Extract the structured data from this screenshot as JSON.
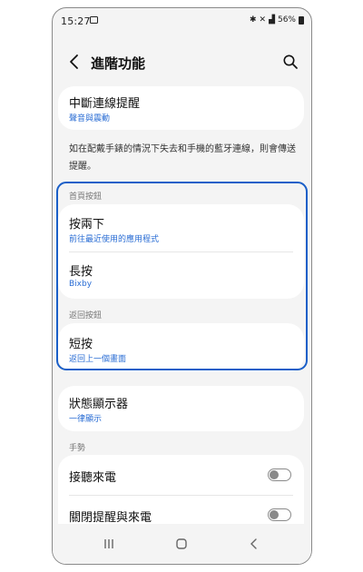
{
  "status_bar": {
    "time": "15:27",
    "right_text": "56%"
  },
  "header": {
    "title": "進階功能",
    "back_icon": "chevron-left-icon",
    "search_icon": "search-icon"
  },
  "disconnect": {
    "title": "中斷連線提醒",
    "subtitle": "聲音與震動",
    "description": "如在配戴手錶的情況下失去和手機的藍牙連線，則會傳送提醒。"
  },
  "home_key": {
    "section": "首頁按鈕",
    "items": [
      {
        "title": "按兩下",
        "subtitle": "前往最近使用的應用程式"
      },
      {
        "title": "長按",
        "subtitle": "Bixby"
      }
    ]
  },
  "back_key": {
    "section": "返回按鈕",
    "items": [
      {
        "title": "短按",
        "subtitle": "返回上一個畫面"
      }
    ]
  },
  "status_indicator": {
    "title": "狀態顯示器",
    "subtitle": "一律顯示"
  },
  "gestures": {
    "section": "手勢",
    "items": [
      {
        "title": "接聽來電",
        "enabled": false
      },
      {
        "title": "關閉提醒與來電",
        "enabled": false
      }
    ]
  },
  "colors": {
    "accent": "#2a6dd4",
    "highlight": "#1a5fc8"
  }
}
